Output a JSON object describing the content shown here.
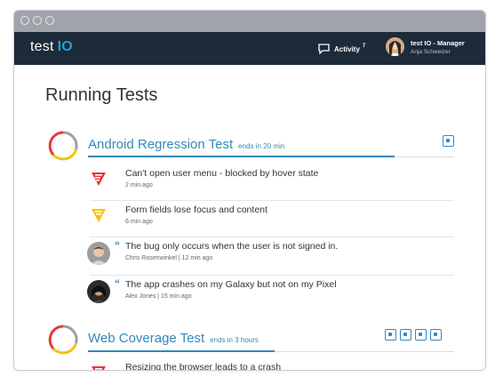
{
  "app": {
    "logo_text": "test",
    "logo_io": "IO"
  },
  "header": {
    "activity_label": "Activity",
    "activity_count": "7",
    "user_name": "test IO - Manager",
    "user_subtitle": "Anja Schweizer"
  },
  "page": {
    "title": "Running Tests"
  },
  "tests": [
    {
      "name": "Android Regression Test",
      "ends": "ends in 20 min",
      "devices": [
        "android-icon"
      ],
      "items": [
        {
          "kind": "bug-critical",
          "text": "Can't open user menu - blocked by hover state",
          "meta": "2 min ago"
        },
        {
          "kind": "bug-medium",
          "text": "Form fields lose focus and content",
          "meta": "6 min ago"
        },
        {
          "kind": "comment",
          "text": "The bug only occurs when the user is not signed in.",
          "meta": "Chris Rosenwinkel | 12 min ago"
        },
        {
          "kind": "comment",
          "text": "The app crashes on my Galaxy but not on my Pixel",
          "meta": "Alex Jones | 15 min ago"
        }
      ]
    },
    {
      "name": "Web Coverage Test",
      "ends": "ends in 3 hours",
      "devices": [
        "android-icon",
        "apple-icon",
        "desktop-icon",
        "windows-icon"
      ],
      "items": [
        {
          "kind": "bug-critical",
          "text": "Resizing the browser leads to a crash",
          "meta": ""
        }
      ]
    }
  ],
  "colors": {
    "accent": "#3489b9",
    "appbar": "#1c2a3a",
    "critical": "#e53935",
    "medium": "#f2c40f"
  }
}
